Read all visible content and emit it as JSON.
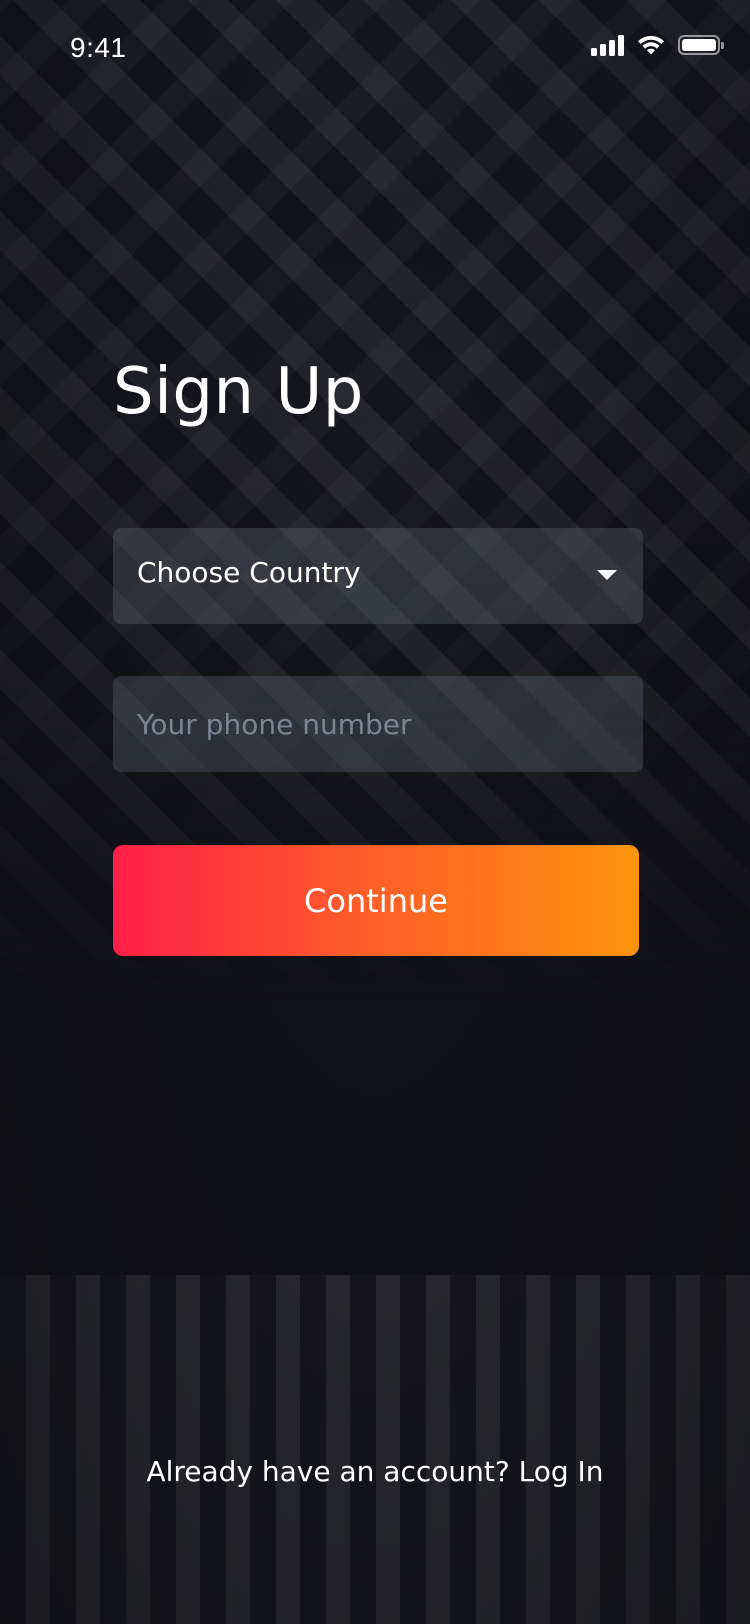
{
  "status_bar": {
    "time": "9:41",
    "icons": [
      "signal-icon",
      "wifi-icon",
      "battery-icon"
    ]
  },
  "page": {
    "title": "Sign Up"
  },
  "form": {
    "country_select_label": "Choose Country",
    "phone_placeholder": "Your phone number",
    "phone_value": "",
    "continue_label": "Continue"
  },
  "footer": {
    "prompt": "Already have an account? ",
    "login_label": "Log In"
  },
  "colors": {
    "background": "#121319",
    "gradient_start": "#ff1f48",
    "gradient_end": "#ff930c",
    "text": "#ffffff",
    "placeholder": "#7d8394"
  }
}
